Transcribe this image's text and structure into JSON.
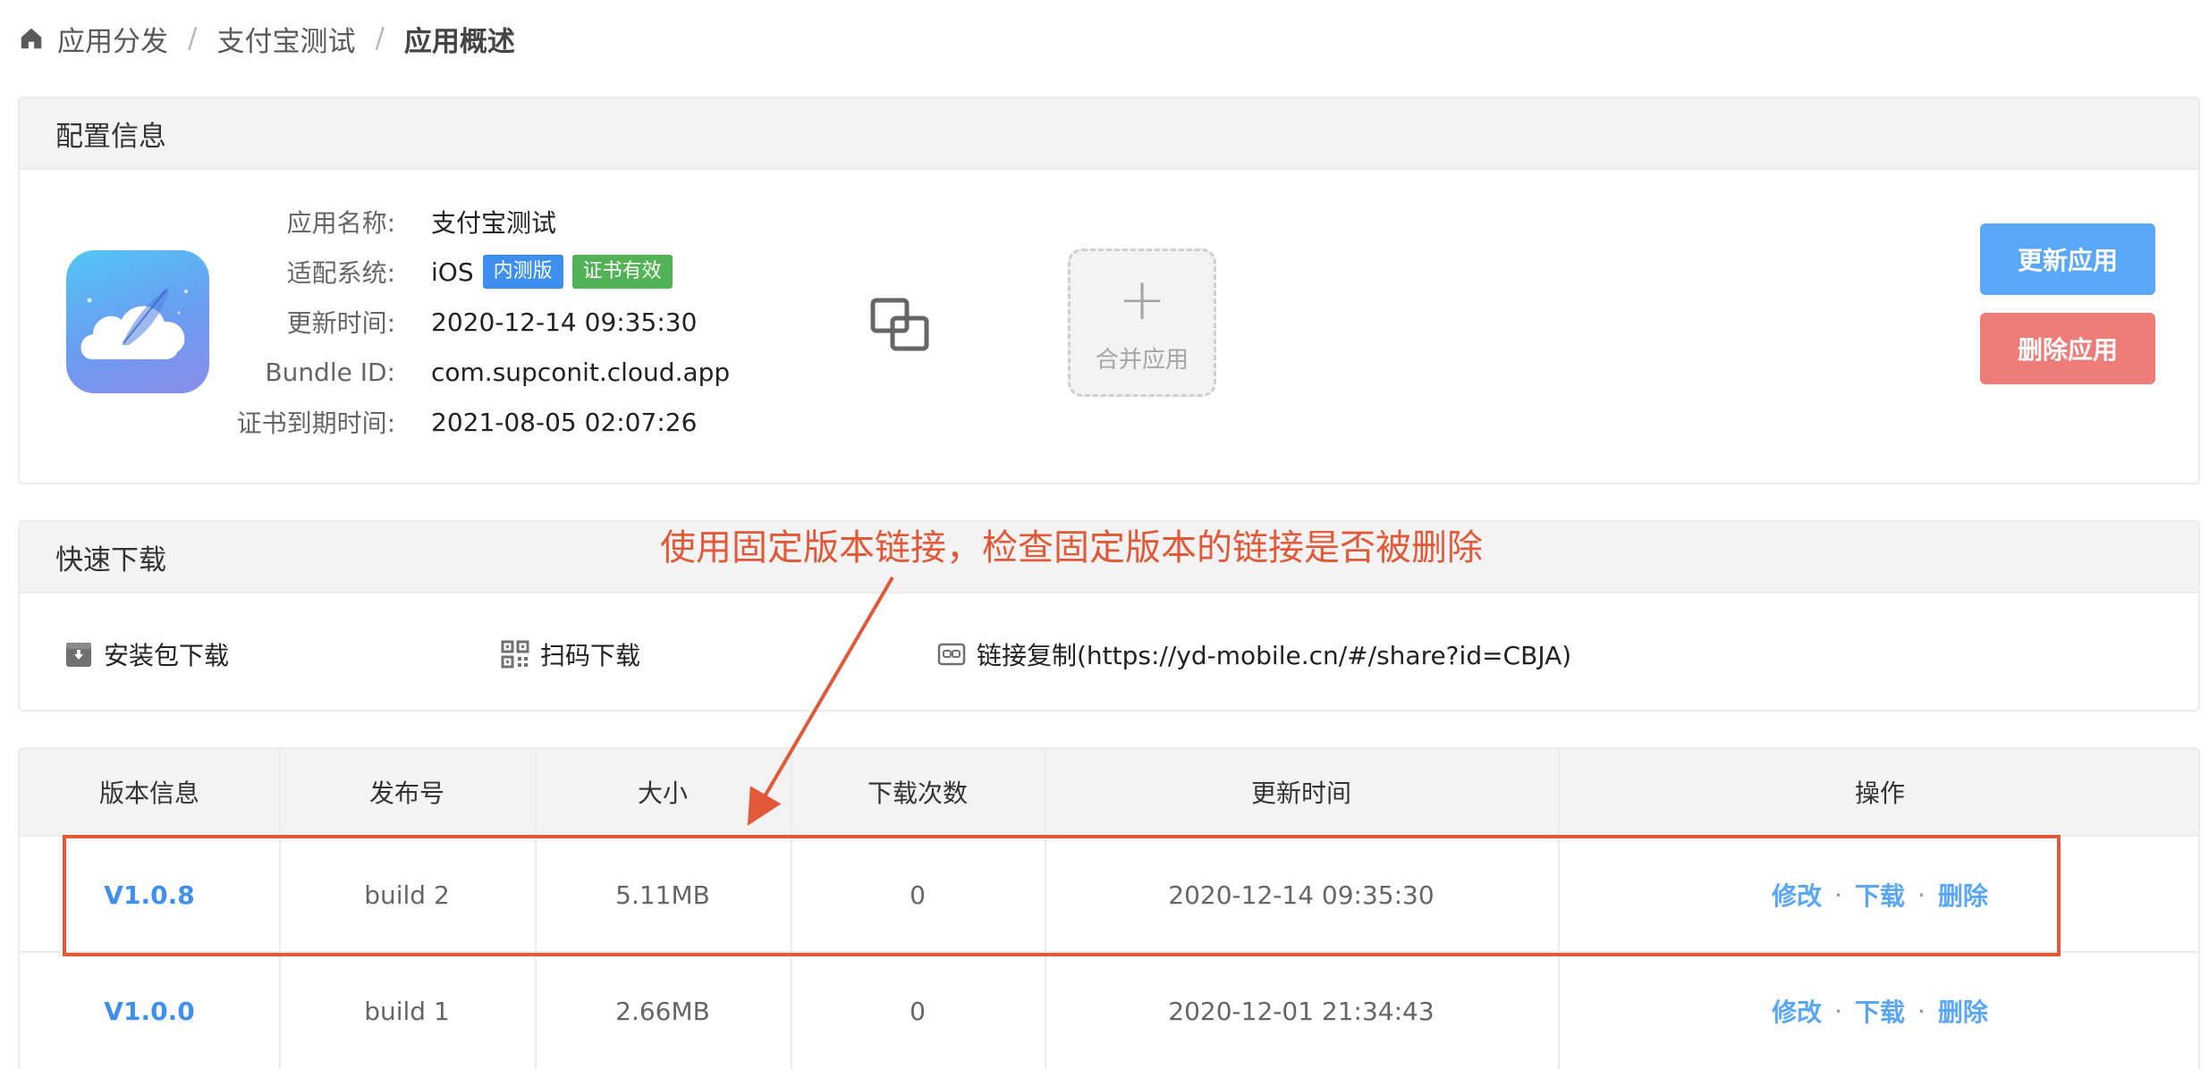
{
  "breadcrumb": {
    "items": [
      "应用分发",
      "支付宝测试",
      "应用概述"
    ],
    "separator": "/"
  },
  "config": {
    "header": "配置信息",
    "app_name_label": "应用名称:",
    "app_name": "支付宝测试",
    "system_label": "适配系统:",
    "system": "iOS",
    "tag_internal": "内测版",
    "tag_cert": "证书有效",
    "updated_label": "更新时间:",
    "updated": "2020-12-14 09:35:30",
    "bundle_label": "Bundle ID:",
    "bundle_id": "com.supconit.cloud.app",
    "cert_expiry_label": "证书到期时间:",
    "cert_expiry": "2021-08-05 02:07:26",
    "merge_label": "合并应用",
    "update_button": "更新应用",
    "delete_button": "删除应用"
  },
  "quick_download": {
    "header": "快速下载",
    "package_download": "安装包下载",
    "scan_download": "扫码下载",
    "copy_link": "链接复制(https://yd-mobile.cn/#/share?id=CBJA)"
  },
  "annotation": {
    "text": "使用固定版本链接，检查固定版本的链接是否被删除",
    "color": "#e05a3a"
  },
  "table": {
    "headers": [
      "版本信息",
      "发布号",
      "大小",
      "下载次数",
      "更新时间",
      "操作"
    ],
    "rows": [
      {
        "version": "V1.0.8",
        "build": "build 2",
        "size": "5.11MB",
        "downloads": "0",
        "updated": "2020-12-14 09:35:30"
      },
      {
        "version": "V1.0.0",
        "build": "build 1",
        "size": "2.66MB",
        "downloads": "0",
        "updated": "2020-12-01 21:34:43"
      }
    ],
    "actions": {
      "edit": "修改",
      "download": "下载",
      "delete": "删除",
      "separator": "·"
    }
  },
  "colors": {
    "accent_blue": "#5aa6f7",
    "danger_red": "#ee7d7a",
    "tag_blue": "#3f8ff0",
    "tag_green": "#54b256"
  }
}
